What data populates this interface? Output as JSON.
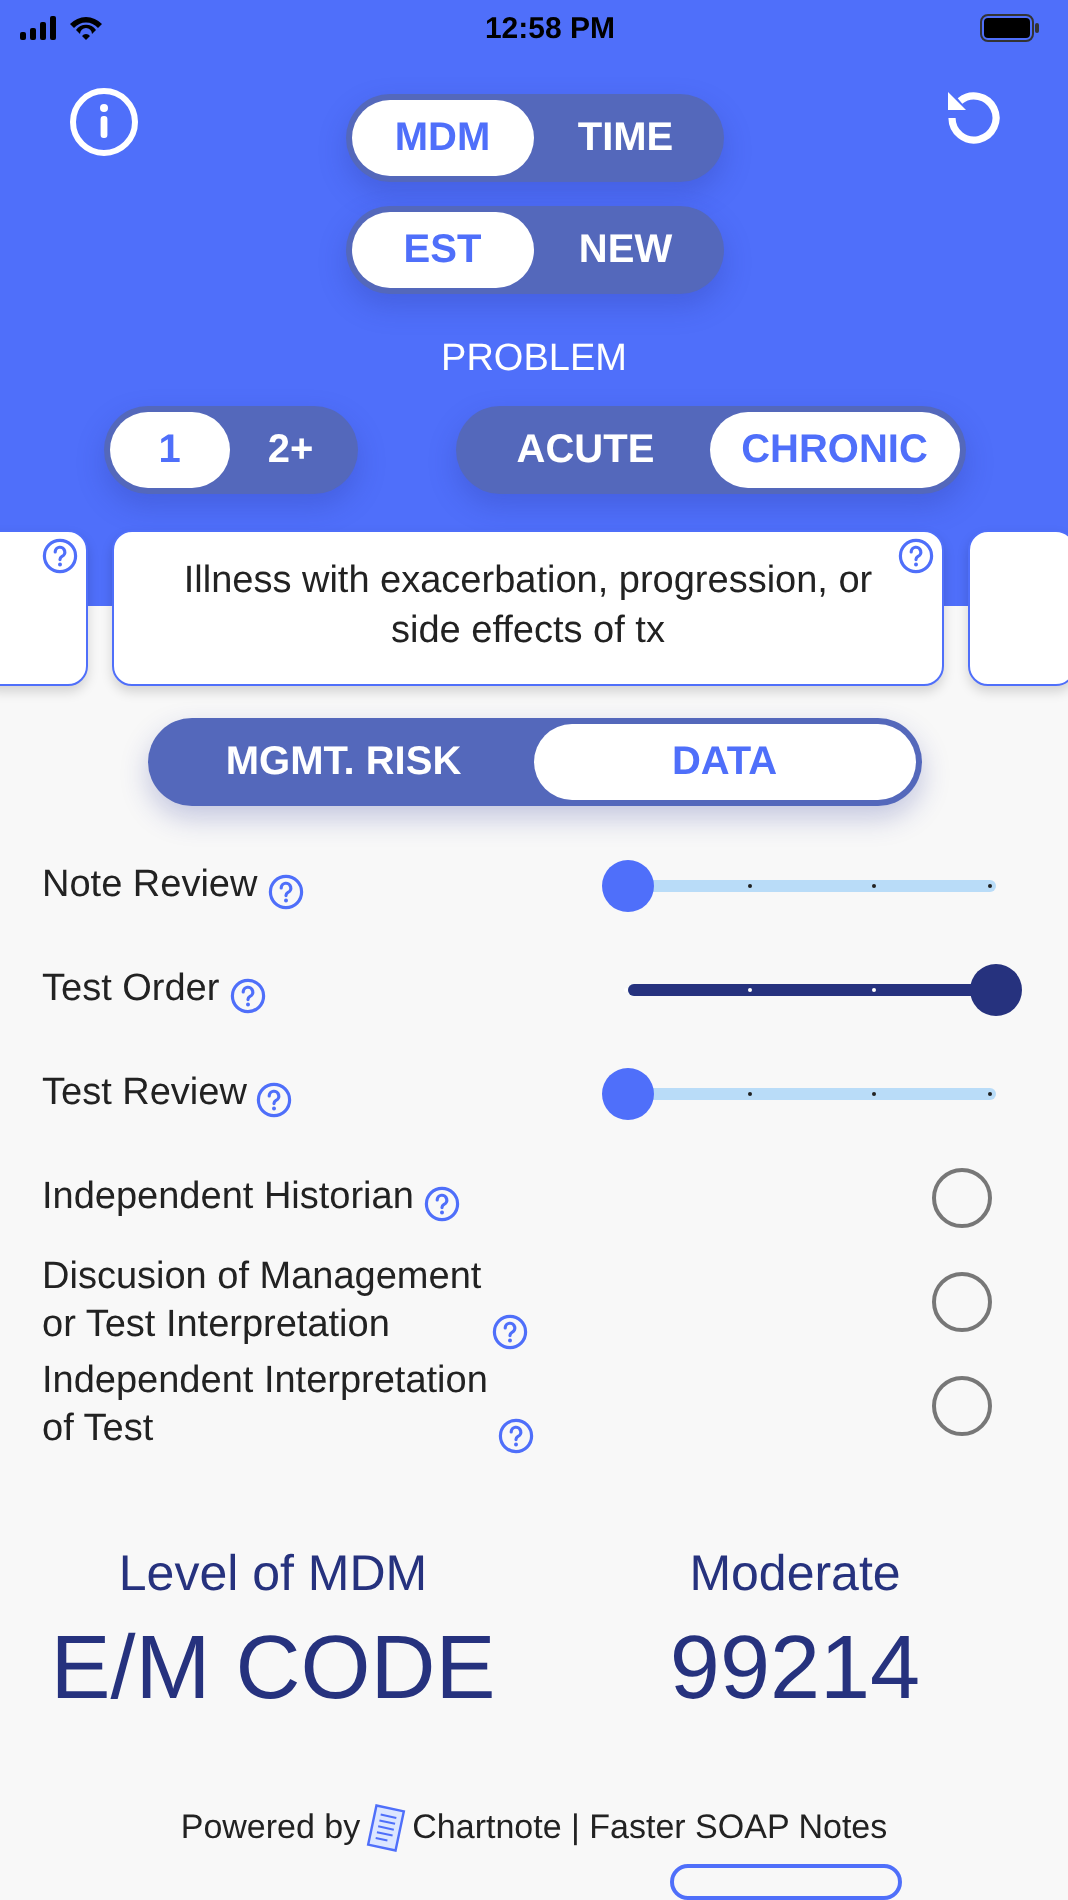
{
  "status_bar": {
    "time": "12:58 PM"
  },
  "mode_toggle": [
    {
      "label": "MDM",
      "selected": true
    },
    {
      "label": "TIME",
      "selected": false
    }
  ],
  "patient_toggle": [
    {
      "label": "EST",
      "selected": true
    },
    {
      "label": "NEW",
      "selected": false
    }
  ],
  "problem": {
    "label": "PROBLEM",
    "count": [
      {
        "label": "1",
        "selected": true
      },
      {
        "label": "2+",
        "selected": false
      }
    ],
    "type": [
      {
        "label": "ACUTE",
        "selected": false
      },
      {
        "label": "CHRONIC",
        "selected": true
      }
    ]
  },
  "problem_card": {
    "text": "Illness with exacerbation, progression, or side effects of tx"
  },
  "section_tabs": [
    {
      "label": "MGMT. RISK",
      "selected": false
    },
    {
      "label": "DATA",
      "selected": true
    }
  ],
  "data_items": [
    {
      "kind": "slider",
      "label": "Note Review",
      "level": 0
    },
    {
      "kind": "slider",
      "label": "Test Order",
      "level": 1
    },
    {
      "kind": "slider",
      "label": "Test Review",
      "level": 0
    },
    {
      "kind": "radio",
      "label": "Independent Historian",
      "checked": false
    },
    {
      "kind": "radio",
      "label": "Discusion of Management\nor Test Interpretation",
      "checked": false
    },
    {
      "kind": "radio",
      "label": "Independent Interpretation\nof Test",
      "checked": false
    }
  ],
  "result": {
    "level_label": "Level of MDM",
    "level_value": "Moderate",
    "code_label": "E/M CODE",
    "code_value": "99214"
  },
  "footer": {
    "prefix": "Powered by",
    "suffix": "Chartnote | Faster SOAP Notes"
  }
}
